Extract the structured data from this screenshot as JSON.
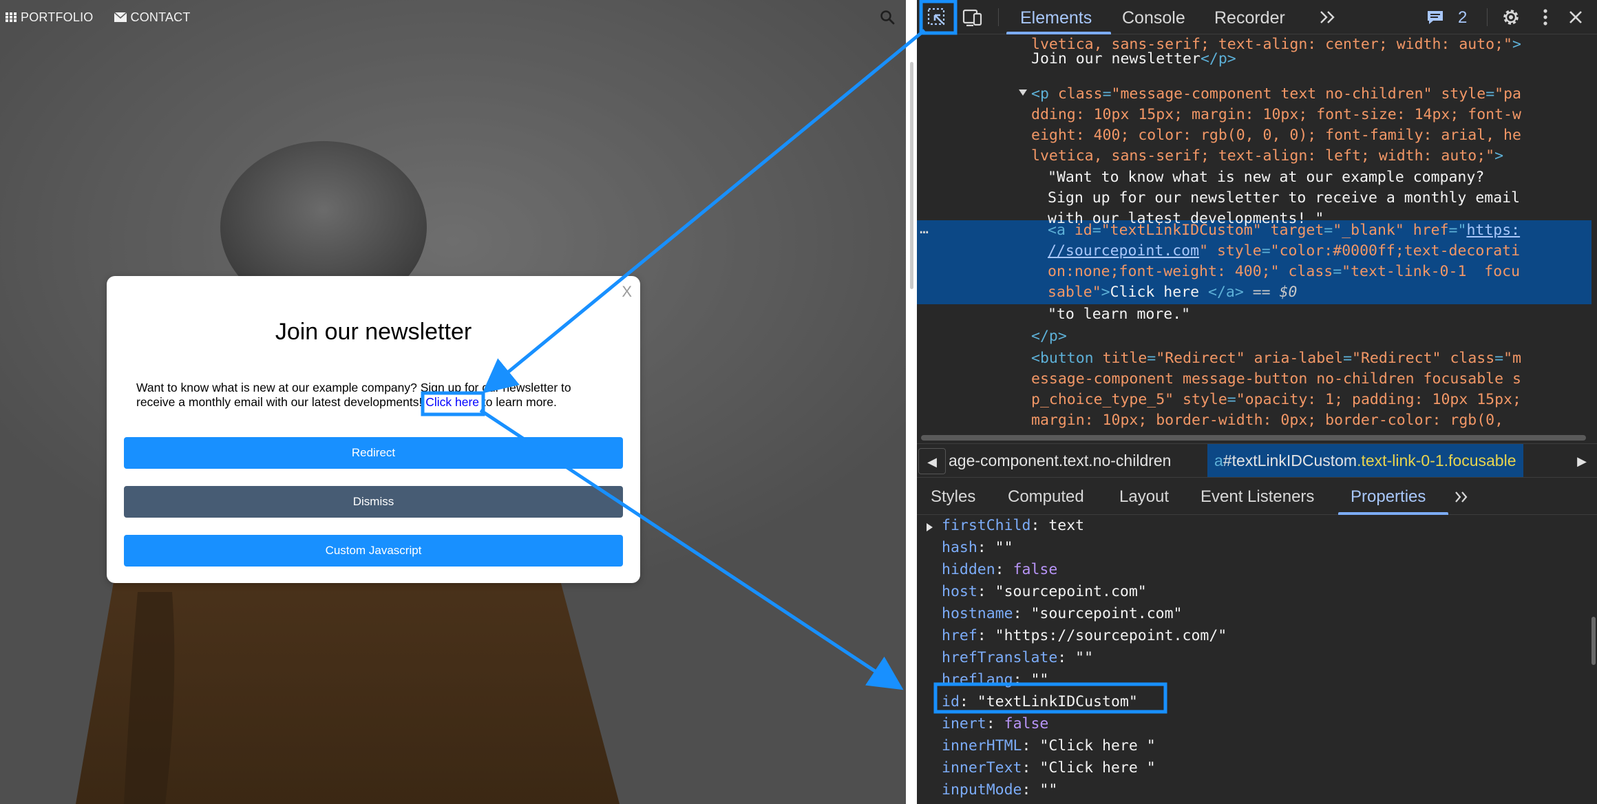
{
  "site": {
    "nav": [
      {
        "label": "PORTFOLIO",
        "icon": "grid-icon"
      },
      {
        "label": "CONTACT",
        "icon": "envelope-icon"
      }
    ],
    "search_icon": "search-icon"
  },
  "modal": {
    "close_label": "X",
    "title": "Join our newsletter",
    "body_text": "Want to know what is new at our example company? Sign up for our newsletter to receive a monthly email with our latest developments! ",
    "link_text": "Click here",
    "trailing_text": " to learn more.",
    "buttons": [
      {
        "label": "Redirect",
        "color": "#1890ff"
      },
      {
        "label": "Dismiss",
        "color": "#475c74"
      },
      {
        "label": "Custom Javascript",
        "color": "#1890ff"
      }
    ]
  },
  "devtools": {
    "tabs": [
      "Elements",
      "Console",
      "Recorder"
    ],
    "active_tab": "Elements",
    "more_tabs_icon": "double-chevron-icon",
    "issues_count": "2",
    "dom": {
      "l1_val": "lvetica, sans-serif; text-align: center; width: auto;\"",
      "l1_close": ">",
      "l2_text": "Join our newsletter",
      "l2_close": "</p>",
      "l3_open": "<p ",
      "l3_attr": "class",
      "l3_eq": "=",
      "l3_val": "\"message-component text no-children\"",
      "l3_attr2": " style",
      "l3_eq2": "=",
      "l3_val2": "\"pa",
      "l4": "dding: 10px 15px; margin: 10px; font-size: 14px; font-w",
      "l5": "eight: 400; color: rgb(0, 0, 0); font-family: arial, he",
      "l6": "lvetica, sans-serif; text-align: left; width: auto;\"",
      "l6_close": ">",
      "l7": "\"Want to know what is new at our example company?",
      "l8": "Sign up for our newsletter to receive a monthly email",
      "l9": "with our latest developments! \"",
      "l10_tag": "<a ",
      "l10_attr": "id",
      "l10_eq": "=",
      "l10_val": "\"textLinkIDCustom\"",
      "l10_attr2": " target",
      "l10_eq2": "=",
      "l10_val2": "\"_blank\"",
      "l10_attr3": " href",
      "l10_eq3": "=\"",
      "l10_link": "https:",
      "l11_link": "//sourcepoint.com",
      "l11_q": "\"",
      "l11_attr": " style",
      "l11_eq": "=",
      "l11_val": "\"color:#0000ff;text-decorati",
      "l12": "on:none;font-weight: 400;\"",
      "l12_attr": " class",
      "l12_eq": "=",
      "l12_val": "\"text-link-0-1  focu",
      "l13_val": "sable\"",
      "l13_close": ">",
      "l13_text": "Click here ",
      "l13_end": "</a>",
      "l13_eq": " == $0",
      "l14": "\"to learn more.\"",
      "l15": "</p>",
      "l16_tag": "<button ",
      "l16_attr": "title",
      "l16_eq": "=",
      "l16_val": "\"Redirect\"",
      "l16_attr2": " aria-label",
      "l16_eq2": "=",
      "l16_val2": "\"Redirect\"",
      "l16_attr3": " class",
      "l16_eq3": "=",
      "l16_val3": "\"m",
      "l17": "essage-component message-button no-children focusable s",
      "l18": "p_choice_type_5\"",
      "l18_attr": " style",
      "l18_eq": "=",
      "l18_val": "\"opacity: 1; padding: 10px 15px;",
      "l19": "margin: 10px; border-width: 0px; border-color: rgb(0,",
      "dots": "…"
    },
    "breadcrumbs": {
      "first": "age-component.text.no-children",
      "selected_tag": "a",
      "selected_id": "#textLinkIDCustom",
      "selected_class": ".text-link-0-1.focusable"
    },
    "sub_tabs": [
      "Styles",
      "Computed",
      "Layout",
      "Event Listeners",
      "Properties"
    ],
    "active_sub_tab": "Properties",
    "properties": [
      {
        "key": "firstChild",
        "value": "text",
        "kind": "plain"
      },
      {
        "key": "hash",
        "value": "\"\"",
        "kind": "str"
      },
      {
        "key": "hidden",
        "value": "false",
        "kind": "bool"
      },
      {
        "key": "host",
        "value": "\"sourcepoint.com\"",
        "kind": "str"
      },
      {
        "key": "hostname",
        "value": "\"sourcepoint.com\"",
        "kind": "str"
      },
      {
        "key": "href",
        "value": "\"https://sourcepoint.com/\"",
        "kind": "str"
      },
      {
        "key": "hrefTranslate",
        "value": "\"\"",
        "kind": "str"
      },
      {
        "key": "hreflang",
        "value": "\"\"",
        "kind": "str"
      },
      {
        "key": "id",
        "value": "\"textLinkIDCustom\"",
        "kind": "str"
      },
      {
        "key": "inert",
        "value": "false",
        "kind": "bool"
      },
      {
        "key": "innerHTML",
        "value": "\"Click here \"",
        "kind": "str"
      },
      {
        "key": "innerText",
        "value": "\"Click here \"",
        "kind": "str"
      },
      {
        "key": "inputMode",
        "value": "\"\"",
        "kind": "str"
      }
    ]
  },
  "colors": {
    "annotation": "#1890ff",
    "devtools_bg": "#282828",
    "selection": "#0c4886"
  }
}
